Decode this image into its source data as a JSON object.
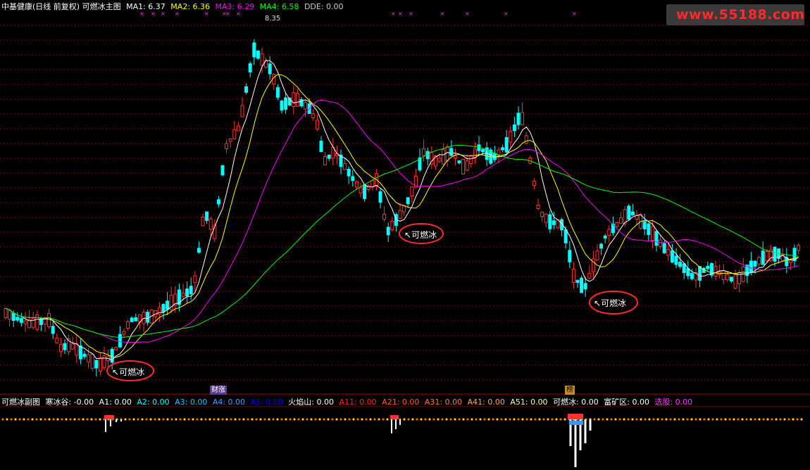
{
  "main_header": [
    {
      "text": "中基健康(日线 前复权) 可燃冰主图",
      "color": "#ffffff"
    },
    {
      "text": "MA1: 6.37",
      "color": "#ffffff"
    },
    {
      "text": "MA2: 6.36",
      "color": "#ffff00"
    },
    {
      "text": "MA3: 6.29",
      "color": "#ff00ff"
    },
    {
      "text": "MA4: 6.58",
      "color": "#00ff00"
    },
    {
      "text": "DDE: 0.00",
      "color": "#cccccc"
    }
  ],
  "sub_header": [
    {
      "text": "可燃冰副图",
      "color": "#ffffff"
    },
    {
      "text": "寒冰谷: -0.00",
      "color": "#ffffff"
    },
    {
      "text": "A1: 0.00",
      "color": "#ffffff"
    },
    {
      "text": "A2: 0.00",
      "color": "#00ffff"
    },
    {
      "text": "A3: 0.00",
      "color": "#00c8ff"
    },
    {
      "text": "A4: 0.00",
      "color": "#4aa0ff"
    },
    {
      "text": "A5: 0.00",
      "color": "#0000ff"
    },
    {
      "text": "火焰山: 0.00",
      "color": "#ffffff"
    },
    {
      "text": "A11: 0.00",
      "color": "#ff2222"
    },
    {
      "text": "A21: 0.00",
      "color": "#ff5a28"
    },
    {
      "text": "A31: 0.00",
      "color": "#ff7a3a"
    },
    {
      "text": "A41: 0.00",
      "color": "#ffaa55"
    },
    {
      "text": "A51: 0.00",
      "color": "#ffffaa"
    },
    {
      "text": "可燃冰: 0.00",
      "color": "#ffffff"
    },
    {
      "text": "富矿区: 0.00",
      "color": "#ffffff"
    },
    {
      "text": "选股: 0.00",
      "color": "#ff33ff"
    }
  ],
  "annotations": {
    "signal_label": "可燃冰",
    "signal_1": "可燃冰",
    "signal_2": "可燃冰",
    "signal_3": "可燃冰",
    "peak_label": "8.35",
    "badge_1": "财涨",
    "badge_2": "榜"
  },
  "logo": {
    "text": "www.55188.com"
  },
  "colors": {
    "up": "#ff3333",
    "down": "#00ffff",
    "ma1": "#ffffff",
    "ma2": "#ffff00",
    "ma3": "#ff00ff",
    "ma4": "#00ff00",
    "grid": "#8b0000"
  }
}
